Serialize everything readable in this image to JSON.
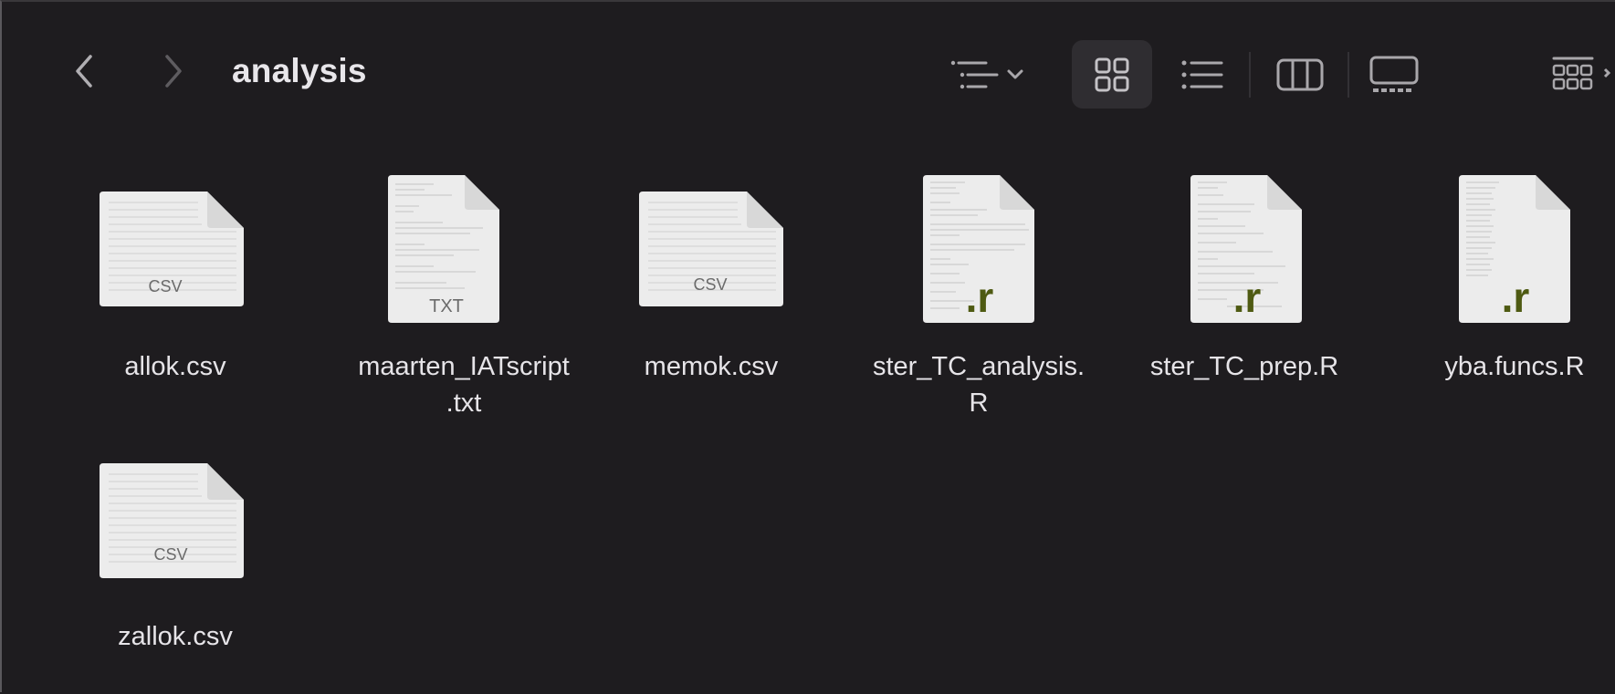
{
  "window": {
    "title": "analysis"
  },
  "toolbar": {
    "back_icon": "chevron-left-icon",
    "forward_icon": "chevron-right-icon",
    "group_icon": "group-by-lines-icon",
    "group_menu_icon": "chevron-down-icon",
    "view_icons": [
      "icon-view-grid-icon",
      "list-view-icon",
      "column-view-icon",
      "gallery-view-icon"
    ],
    "active_view": "icon-view-grid-icon",
    "overflow_icon": "more-views-grid-icon"
  },
  "files": [
    {
      "name_lines": [
        "allok.csv"
      ],
      "type": "csv",
      "badge": "CSV"
    },
    {
      "name_lines": [
        "maarten_IATscript",
        ".txt"
      ],
      "type": "txt",
      "badge": "TXT"
    },
    {
      "name_lines": [
        "memok.csv"
      ],
      "type": "csv",
      "badge": "CSV"
    },
    {
      "name_lines": [
        "ster_TC_analysis.",
        "R"
      ],
      "type": "r",
      "badge": ".r"
    },
    {
      "name_lines": [
        "ster_TC_prep.R"
      ],
      "type": "r",
      "badge": ".r"
    },
    {
      "name_lines": [
        "yba.funcs.R"
      ],
      "type": "r",
      "badge": ".r"
    },
    {
      "name_lines": [
        "zallok.csv"
      ],
      "type": "csv",
      "badge": "CSV"
    }
  ],
  "colors": {
    "background": "#1e1c1f",
    "text": "#e6e4e8",
    "icon": "#a9a7ab",
    "r_badge": "#4e5a12",
    "doc_badge": "#6b6b6b"
  }
}
